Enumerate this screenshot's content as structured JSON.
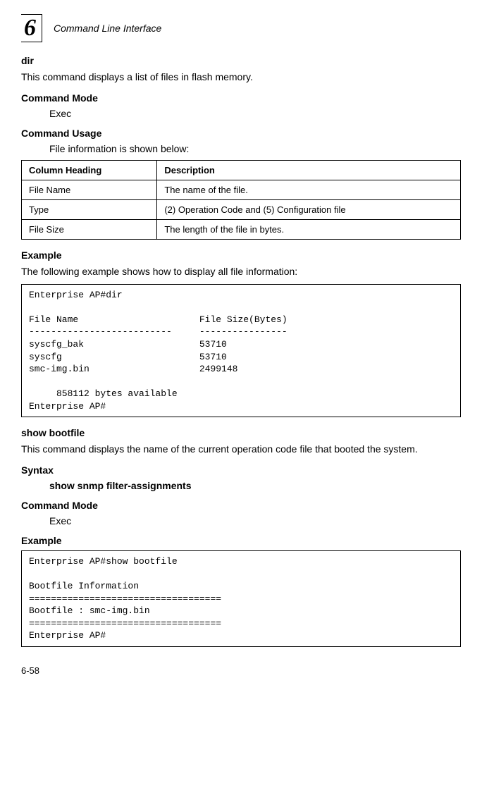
{
  "header": {
    "chapter_num": "6",
    "title": "Command Line Interface"
  },
  "sections": {
    "dir_heading": "dir",
    "dir_desc": "This command displays a list of files in flash memory.",
    "command_mode_label": "Command Mode",
    "exec": "Exec",
    "command_usage_label": "Command Usage",
    "command_usage_text": "File information is shown below:",
    "example_label": "Example",
    "example_text": "The following example shows how to display all file information:",
    "show_bootfile_heading": "show bootfile",
    "show_bootfile_desc": "This command displays the name of the current operation code file that booted the system.",
    "syntax_label": "Syntax",
    "syntax_text": "show snmp filter-assignments"
  },
  "table": {
    "head_col1": "Column Heading",
    "head_col2": "Description",
    "row1_col1": "File Name",
    "row1_col2": "The name of the file.",
    "row2_col1": "Type",
    "row2_col2": "(2) Operation Code and (5) Configuration file",
    "row3_col1": "File Size",
    "row3_col2": "The length of the file in bytes."
  },
  "code1": "Enterprise AP#dir\n\nFile Name                      File Size(Bytes)\n--------------------------     ----------------\nsyscfg_bak                     53710\nsyscfg                         53710\nsmc-img.bin                    2499148\n\n     858112 bytes available\nEnterprise AP#",
  "code2": "Enterprise AP#show bootfile\n\nBootfile Information\n===================================\nBootfile : smc-img.bin\n===================================\nEnterprise AP#",
  "footer": {
    "page_num": "6-58"
  },
  "chart_data": {
    "type": "table",
    "title": "File information columns",
    "columns": [
      "Column Heading",
      "Description"
    ],
    "rows": [
      [
        "File Name",
        "The name of the file."
      ],
      [
        "Type",
        "(2) Operation Code and (5) Configuration file"
      ],
      [
        "File Size",
        "The length of the file in bytes."
      ]
    ]
  }
}
